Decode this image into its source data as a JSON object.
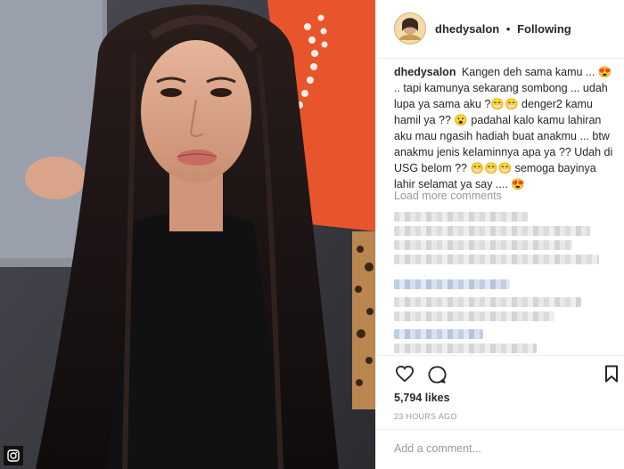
{
  "post": {
    "username": "dhedysalon",
    "separator": "•",
    "follow_status": "Following",
    "caption_user": "dhedysalon",
    "caption": "Kangen deh sama kamu ... 😍 .. tapi kamunya sekarang sombong ... udah lupa ya sama aku ?😁😁 denger2 kamu hamil ya ?? 😮 padahal kalo kamu lahiran aku mau ngasih hadiah buat anakmu ... btw anakmu jenis kelaminnya apa ya ?? Udah di USG belom ?? 😁😁😁 semoga bayinya lahir selamat ya say .... 😍",
    "load_more": "Load more comments",
    "likes": "5,794 likes",
    "time": "23 HOURS AGO",
    "add_comment_placeholder": "Add a comment..."
  },
  "icons": {
    "like": "heart-icon",
    "comment": "comment-icon",
    "save": "bookmark-icon",
    "photo_badge": "instagram-logo-icon"
  },
  "colors": {
    "text": "#262626",
    "muted": "#999999",
    "border": "#efefef"
  }
}
